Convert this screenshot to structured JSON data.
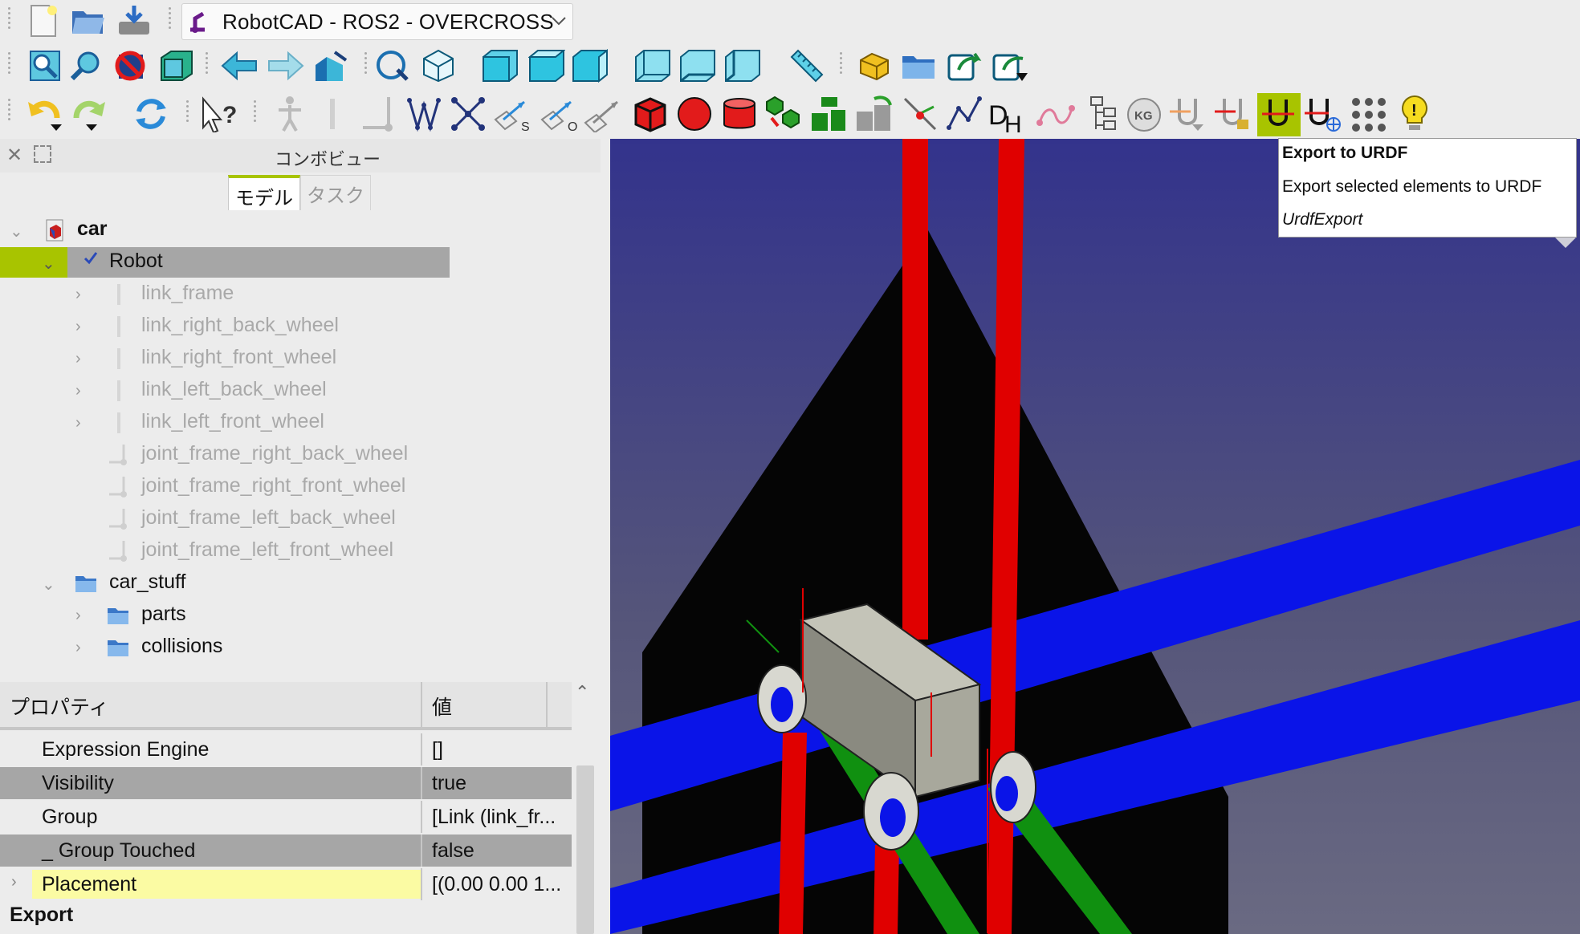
{
  "workbench": {
    "name": "RobotCAD - ROS2 - OVERCROSS"
  },
  "combo_view": {
    "title": "コンボビュー",
    "tabs": [
      {
        "label": "モデル"
      },
      {
        "label": "タスク"
      }
    ]
  },
  "tree": {
    "root": "car",
    "robot": "Robot",
    "links": [
      "link_frame",
      "link_right_back_wheel",
      "link_right_front_wheel",
      "link_left_back_wheel",
      "link_left_front_wheel"
    ],
    "joints": [
      "joint_frame_right_back_wheel",
      "joint_frame_right_front_wheel",
      "joint_frame_left_back_wheel",
      "joint_frame_left_front_wheel"
    ],
    "group": "car_stuff",
    "subgroups": [
      "parts",
      "collisions"
    ]
  },
  "properties": {
    "header_name": "プロパティ",
    "header_value": "値",
    "rows": [
      {
        "name": "Expression Engine",
        "value": "[]"
      },
      {
        "name": "Visibility",
        "value": "true"
      },
      {
        "name": "Group",
        "value": "[Link (link_fr..."
      },
      {
        "name": "_ Group Touched",
        "value": "false"
      },
      {
        "name": "Placement",
        "value": "[(0.00 0.00 1..."
      }
    ],
    "section": "Export"
  },
  "tooltip": {
    "title": "Export to URDF",
    "description": "Export selected elements to URDF",
    "command": "UrdfExport"
  },
  "toolbar_icons": {
    "row1": [
      "new-document-icon",
      "open-folder-icon",
      "save-icon",
      "undo-icon",
      "redo-icon",
      "refresh-icon",
      "whats-this-icon"
    ],
    "highlighted": "export-urdf-icon"
  },
  "colors": {
    "accent": "#a8c400",
    "tree_selection": "#a6a6a6",
    "placement_highlight": "#fbfba3",
    "viewport_top": "#33338c",
    "axis_red": "#e00000",
    "axis_green": "#109010",
    "axis_blue": "#0a14e8"
  }
}
